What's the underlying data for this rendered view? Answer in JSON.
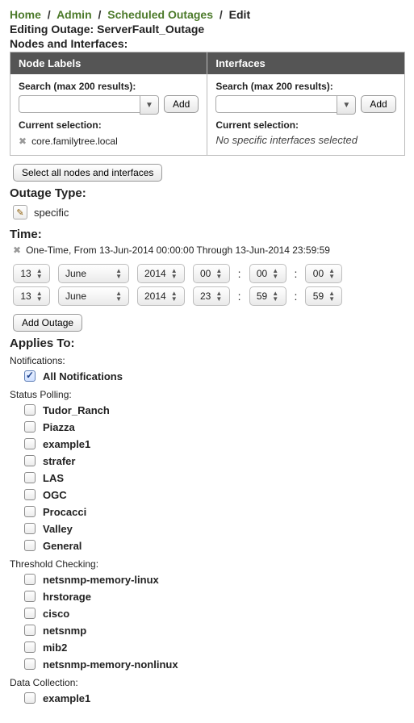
{
  "crumbs": {
    "home": "Home",
    "admin": "Admin",
    "scheduled": "Scheduled Outages",
    "edit": "Edit"
  },
  "editing": "Editing Outage: ServerFault_Outage",
  "nodes_if_title": "Nodes and Interfaces:",
  "panel": {
    "nodes_header": "Node Labels",
    "if_header": "Interfaces",
    "search_label": "Search (max 200 results):",
    "add": "Add",
    "cur_sel": "Current selection:",
    "nodes_selected": [
      "core.familytree.local"
    ],
    "if_none": "No specific interfaces selected"
  },
  "select_all": "Select all nodes and interfaces",
  "outage_type": {
    "title": "Outage Type:",
    "value": "specific"
  },
  "time": {
    "title": "Time:",
    "summary": "One-Time, From 13-Jun-2014 00:00:00 Through 13-Jun-2014 23:59:59",
    "from": {
      "day": "13",
      "month": "June",
      "year": "2014",
      "h": "00",
      "m": "00",
      "s": "00"
    },
    "to": {
      "day": "13",
      "month": "June",
      "year": "2014",
      "h": "23",
      "m": "59",
      "s": "59"
    },
    "add_btn": "Add Outage"
  },
  "applies": {
    "title": "Applies To:",
    "notifications_label": "Notifications:",
    "all_notifications": "All Notifications",
    "status_label": "Status Polling:",
    "status_items": [
      "Tudor_Ranch",
      "Piazza",
      "example1",
      "strafer",
      "LAS",
      "OGC",
      "Procacci",
      "Valley",
      "General"
    ],
    "thresh_label": "Threshold Checking:",
    "thresh_items": [
      "netsnmp-memory-linux",
      "hrstorage",
      "cisco",
      "netsnmp",
      "mib2",
      "netsnmp-memory-nonlinux"
    ],
    "datacol_label": "Data Collection:",
    "datacol_items": [
      "example1"
    ]
  }
}
